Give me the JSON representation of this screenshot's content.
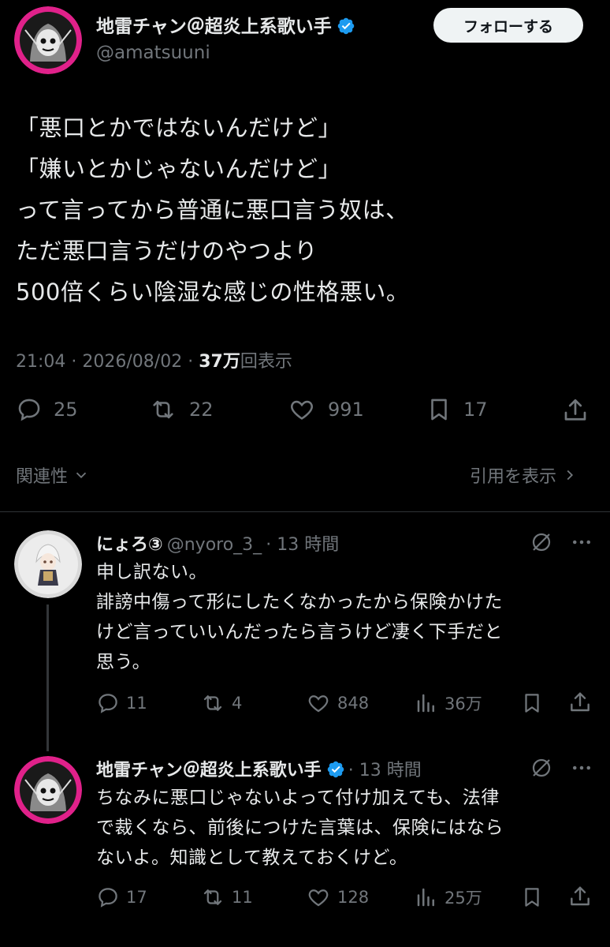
{
  "post": {
    "author_name": "地雷チャン＠超炎上系歌い手",
    "author_handle": "@amatsuuni",
    "follow_label": "フォローする",
    "text_lines": [
      "「悪口とかではないんだけど」",
      "「嫌いとかじゃないんだけど」",
      "って言ってから普通に悪口言う奴は、",
      "ただ悪口言うだけのやつより",
      "500倍くらい陰湿な感じの性格悪い。"
    ],
    "time": "21:04",
    "date": "2026/08/02",
    "sep": "·",
    "views_count": "37万",
    "views_label": "回表示",
    "replies": "25",
    "reposts": "22",
    "likes": "991",
    "bookmarks": "17",
    "relevance_label": "関連性",
    "quotes_label": "引用を表示"
  },
  "replies": [
    {
      "name": "にょろ③",
      "handle": "@nyoro_3_",
      "time": "· 13 時間",
      "text_lines": [
        "申し訳ない。",
        "誹謗中傷って形にしたくなかったから保険かけた",
        "けど言っていいんだったら言うけど凄く下手だと",
        "思う。"
      ],
      "replies": "11",
      "reposts": "4",
      "likes": "848",
      "views": "36万"
    },
    {
      "name": "地雷チャン＠超炎上系歌い手",
      "handle": "",
      "time": "· 13 時間",
      "text_lines": [
        "ちなみに悪口じゃないよって付け加えても、法律",
        "で裁くなら、前後につけた言葉は、保険にはなら",
        "ないよ。知識として教えておくけど。"
      ],
      "replies": "17",
      "reposts": "11",
      "likes": "128",
      "views": "25万"
    }
  ],
  "colors": {
    "background": "#000000",
    "text": "#e7e9ea",
    "muted": "#71767b",
    "verified": "#1d9bf0",
    "avatar_ring": "#e0218a"
  }
}
